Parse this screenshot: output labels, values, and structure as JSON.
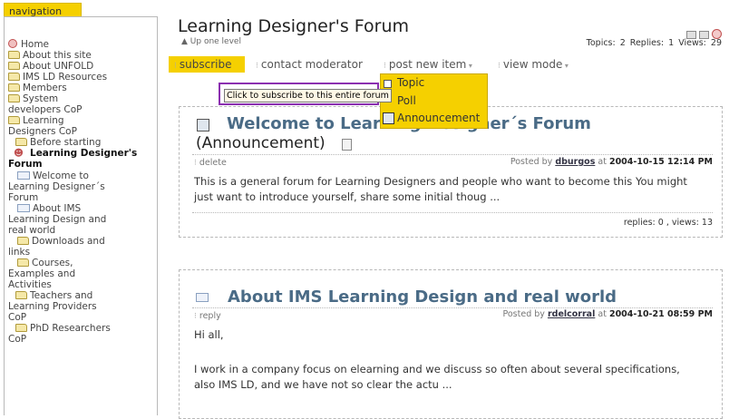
{
  "sidebar": {
    "tab_label": "navigation",
    "items": [
      {
        "label": "Home"
      },
      {
        "label": "About this site"
      },
      {
        "label": "About UNFOLD"
      },
      {
        "label": "IMS LD Resources"
      },
      {
        "label": "Members"
      },
      {
        "label": "System developers CoP"
      },
      {
        "label": "Learning Designers CoP"
      },
      {
        "label": "Before starting"
      },
      {
        "label": "Learning Designer's Forum"
      },
      {
        "label": "Welcome to Learning Designer´s Forum"
      },
      {
        "label": "About IMS Learning Design and real world"
      },
      {
        "label": "Downloads and links"
      },
      {
        "label": "Courses, Examples and Activities"
      },
      {
        "label": "Teachers and Learning Providers CoP"
      },
      {
        "label": "PhD Researchers CoP"
      }
    ]
  },
  "header": {
    "title": "Learning Designer's Forum",
    "up_one_level": "▲ Up one level",
    "stats": "Topics: 2  Replies: 1  Views: 29"
  },
  "actions": {
    "subscribe": "subscribe",
    "contact_moderator": "contact moderator",
    "post_new_item": "post new item",
    "view_mode": "view mode"
  },
  "tooltip": "Click to subscribe to this entire forum",
  "dropdown": {
    "items": [
      "Topic",
      "Poll",
      "Announcement"
    ]
  },
  "posts": [
    {
      "title": "Welcome to Learning Designer´s Forum",
      "title_suffix": "(Announcement)",
      "action": "delete",
      "posted_by_prefix": "Posted by",
      "author": "dburgos",
      "at": "at",
      "date": "2004-10-15 12:14 PM",
      "body": "This is a general forum for Learning Designers and people who want to become this You might just want to introduce yourself, share some initial thoug ...",
      "footer": "replies: 0 , views: 13"
    },
    {
      "title": "About IMS Learning Design and real world",
      "action": "reply",
      "posted_by_prefix": "Posted by",
      "author": "rdelcorral",
      "at": "at",
      "date": "2004-10-21 08:59 PM",
      "body_1": "Hi all,",
      "body_2": "I work in a company focus on elearning and we discuss so often about several specifications, also IMS LD, and we have not so clear the actu ..."
    }
  ]
}
